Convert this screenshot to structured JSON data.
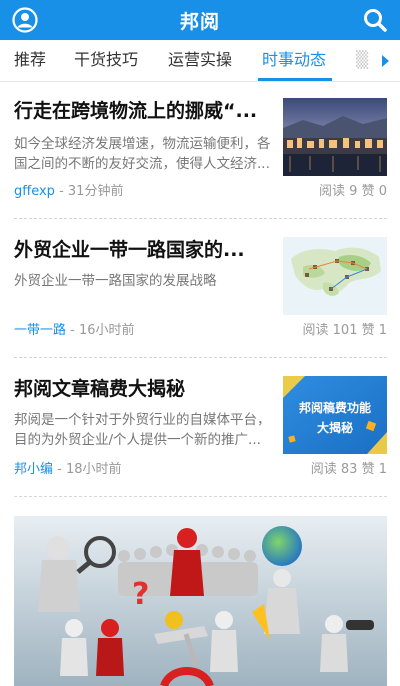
{
  "header": {
    "title": "邦阅",
    "left_icon": "user-circle-icon",
    "right_icon": "search-icon",
    "color": "#1890e8"
  },
  "tabs": [
    {
      "label": "推荐"
    },
    {
      "label": "干货技巧"
    },
    {
      "label": "运营实操"
    },
    {
      "label": "时事动态",
      "active": true
    }
  ],
  "articles": [
    {
      "title": "行走在跨境物流上的挪威“...",
      "summary": "如今全球经济发展增速，物流运输便利，各国之间的不断的友好交流，使得人文经济...",
      "author": "gffexp",
      "time": "31分钟前",
      "stats": "阅读 9  赞 0"
    },
    {
      "title": "外贸企业一带一路国家的...",
      "summary": "外贸企业一带一路国家的发展战略",
      "author": "一带一路",
      "time": "16小时前",
      "stats": "阅读 101  赞 1"
    },
    {
      "title": "邦阅文章稿费大揭秘",
      "summary": "邦阅是一个针对于外贸行业的自媒体平台，目的为外贸企业/个人提供一个新的推广...",
      "author": "邦小编",
      "time": "18小时前",
      "stats": "阅读 83  赞 1",
      "thumb_text": [
        "邦阅稿费功能",
        "大揭秘"
      ]
    }
  ]
}
